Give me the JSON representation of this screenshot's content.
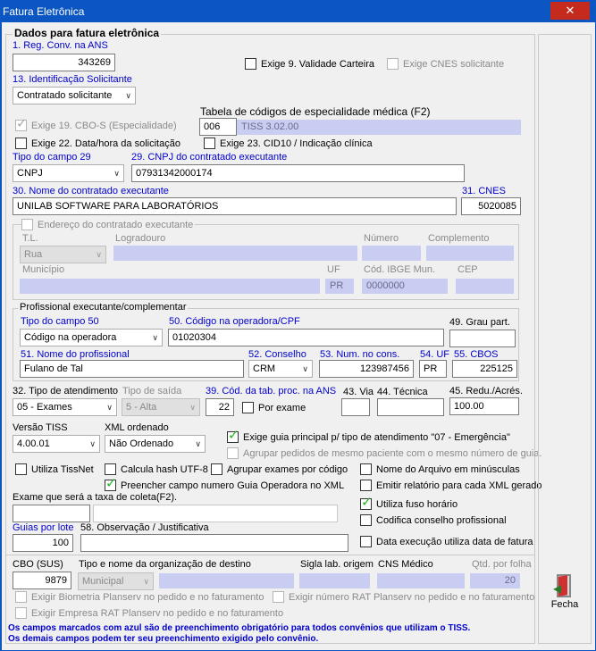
{
  "window": {
    "title": "Fatura Eletrônica",
    "close": "✕"
  },
  "section": {
    "title": "Dados para fatura eletrônica"
  },
  "reg_conv": {
    "label": "1. Reg. Conv. na  ANS",
    "value": "343269"
  },
  "exige9": {
    "label": "Exige 9. Validade Carteira"
  },
  "exige_cnes": {
    "label": "Exige CNES solicitante"
  },
  "ident": {
    "label": "13. Identificação Solicitante",
    "value": "Contratado solicitante"
  },
  "tabela": {
    "label": "Tabela de códigos de especialidade médica (F2)",
    "code": "006",
    "desc": "TISS 3.02.00"
  },
  "exige19": {
    "label": "Exige 19. CBO-S (Especialidade)"
  },
  "exige22": {
    "label": "Exige 22. Data/hora da solicitação"
  },
  "exige23": {
    "label": "Exige 23. CID10 / Indicação clínica"
  },
  "tipo29": {
    "label": "Tipo do campo 29",
    "value": "CNPJ"
  },
  "cnpj29": {
    "label": "29. CNPJ do contratado executante",
    "value": "07931342000174"
  },
  "nome30": {
    "label": "30. Nome do contratado executante",
    "value": "UNILAB SOFTWARE PARA LABORATÓRIOS"
  },
  "cnes31": {
    "label": "31. CNES",
    "value": "5020085"
  },
  "endereco": {
    "label": "Endereço do contratado executante",
    "tl_label": "T.L.",
    "tl_value": "Rua",
    "logradouro": "Logradouro",
    "numero": "Número",
    "complemento": "Complemento",
    "municipio": "Município",
    "uf": "UF",
    "uf_value": "PR",
    "ibge": "Cód. IBGE Mun.",
    "ibge_value": "0000000",
    "cep": "CEP"
  },
  "prof": {
    "label": "Profissional executante/complementar",
    "tipo50_label": "Tipo do campo 50",
    "tipo50_value": "Código na operadora",
    "cod50_label": "50. Código na operadora/CPF",
    "cod50_value": "01020304",
    "grau_label": "49. Grau part.",
    "nome51_label": "51. Nome do profissional",
    "nome51_value": "Fulano de Tal",
    "cons52_label": "52. Conselho",
    "cons52_value": "CRM",
    "num53_label": "53. Num. no cons.",
    "num53_value": "123987456",
    "uf54_label": "54. UF",
    "uf54_value": "PR",
    "cbos55_label": "55. CBOS",
    "cbos55_value": "225125"
  },
  "atend": {
    "label": "32. Tipo de atendimento",
    "value": "05 - Exames",
    "saida_label": "Tipo de saída",
    "saida_value": "5 - Alta",
    "tab39_label": "39. Cód. da tab. proc. na ANS",
    "tab39_value": "22",
    "por_exame": "Por exame",
    "via_label": "43. Via",
    "tecnica_label": "44. Técnica",
    "redu_label": "45. Redu./Acrés.",
    "redu_value": "100.00"
  },
  "versao": {
    "label": "Versão TISS",
    "value": "4.00.01"
  },
  "xml": {
    "label": "XML ordenado",
    "value": "Não Ordenado"
  },
  "chk_guia": "Exige guia principal p/ tipo de atendimento \"07 - Emergência\"",
  "chk_agrupar_ped": "Agrupar pedidos de mesmo paciente com o mesmo número de guia.",
  "chk_tissnet": "Utiliza TissNet",
  "chk_hash": "Calcula hash UTF-8",
  "chk_agrupar_ex": "Agrupar exames por código",
  "chk_nome_arq": "Nome do Arquivo em minúsculas",
  "chk_preencher": "Preencher campo numero Guia Operadora no XML",
  "chk_emitir": "Emitir relatório para cada XML gerado",
  "exame_taxa": {
    "label": "Exame que será a taxa de coleta(F2)."
  },
  "chk_fuso": "Utiliza fuso horário",
  "chk_codifica": "Codifica conselho profissional",
  "guias": {
    "label": "Guias por lote",
    "value": "100"
  },
  "obs": {
    "label": "58. Observação / Justificativa"
  },
  "chk_data_exec": "Data execução utiliza data de fatura",
  "cbo": {
    "label": "CBO (SUS)",
    "value": "9879",
    "org_label": "Tipo e nome da organização de destino",
    "org_value": "Municipal",
    "sigla_label": "Sigla  lab. origem",
    "cns_label": "CNS Médico",
    "qtd_label": "Qtd. por folha",
    "qtd_value": "20"
  },
  "chk_biometria": "Exigir Biometria Planserv no pedido e no faturamento",
  "chk_rat": "Exigir número RAT Planserv no pedido e no faturamento",
  "chk_empresa": "Exigir Empresa RAT Planserv no pedido e no faturamento",
  "fecha": "Fecha",
  "footer1": "Os campos marcados com azul são de preenchimento obrigatório para todos convênios que utilizam o TISS.",
  "footer2": "Os demais campos podem ter seu preenchimento exigido pelo convênio."
}
